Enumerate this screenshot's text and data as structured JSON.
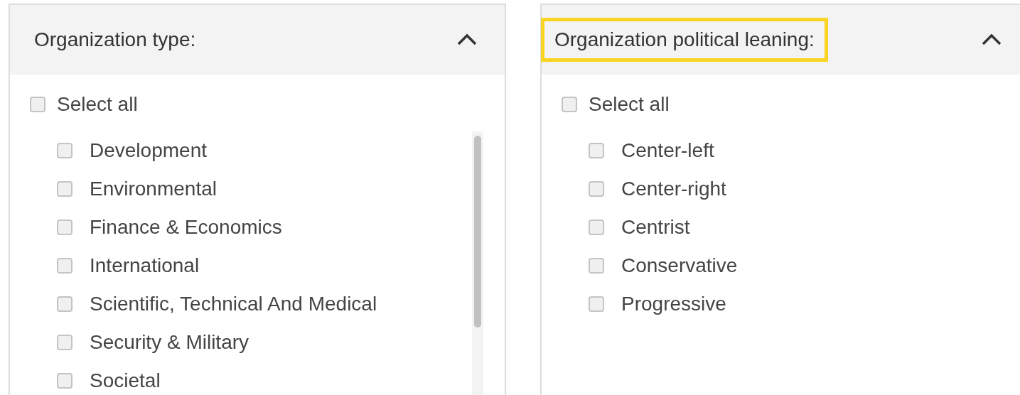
{
  "panels": [
    {
      "title": "Organization type:",
      "highlighted": false,
      "expanded": true,
      "scrollbar": true,
      "select_all": {
        "label": "Select all",
        "checked": false
      },
      "options": [
        {
          "label": "Development",
          "checked": false
        },
        {
          "label": "Environmental",
          "checked": false
        },
        {
          "label": "Finance & Economics",
          "checked": false
        },
        {
          "label": "International",
          "checked": false
        },
        {
          "label": "Scientific, Technical And Medical",
          "checked": false
        },
        {
          "label": "Security & Military",
          "checked": false
        },
        {
          "label": "Societal",
          "checked": false
        }
      ]
    },
    {
      "title": "Organization political leaning:",
      "highlighted": true,
      "expanded": true,
      "scrollbar": false,
      "select_all": {
        "label": "Select all",
        "checked": false
      },
      "options": [
        {
          "label": "Center-left",
          "checked": false
        },
        {
          "label": "Center-right",
          "checked": false
        },
        {
          "label": "Centrist",
          "checked": false
        },
        {
          "label": "Conservative",
          "checked": false
        },
        {
          "label": "Progressive",
          "checked": false
        }
      ]
    }
  ]
}
